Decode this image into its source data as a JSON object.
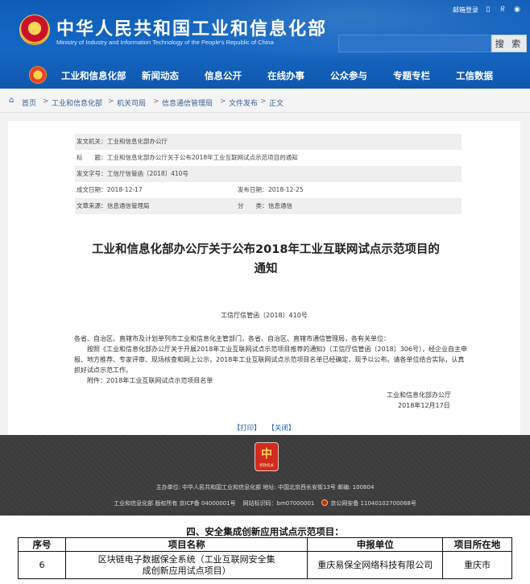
{
  "header": {
    "site_title": "中华人民共和国工业和信息化部",
    "site_subtitle": "Ministry of Industry and Information Technology of the People's Republic of China",
    "mail_login": "邮箱登录",
    "search_button": "搜 索",
    "nav": [
      "工业和信息化部",
      "新闻动态",
      "信息公开",
      "在线办事",
      "公众参与",
      "专题专栏",
      "工信数据"
    ]
  },
  "breadcrumb": [
    "首页",
    "工业和信息化部",
    "机关司局",
    "信息通信管理局",
    "文件发布",
    "正文"
  ],
  "meta": {
    "issuer_label": "发文机关：",
    "issuer": "工业和信息化部办公厅",
    "title_label": "标　　题：",
    "title": "工业和信息化部办公厅关于公布2018年工业互联网试点示范项目的通知",
    "doc_no_label": "发文字号：",
    "doc_no": "工信厅信管函〔2018〕410号",
    "created_label": "成文日期：",
    "created": "2018-12-17",
    "published_label": "发布日期：",
    "published": "2018-12-25",
    "source_label": "文章来源：",
    "source": "信息通信管理局",
    "category_label": "分　　类：",
    "category": "信息通信"
  },
  "document": {
    "title_line1": "工业和信息化部办公厅关于公布2018年工业互联网试点示范项目的",
    "title_line2": "通知",
    "number": "工信厅信管函〔2018〕410号",
    "para1": "各省、自治区、直辖市及计划单列市工业和信息化主管部门，各省、自治区、直辖市通信管理局，各有关单位：",
    "para2": "按照《工业和信息化部办公厅关于开展2018年工业互联网试点示范项目推荐的通知》（工信厅信管函〔2018〕306号），经企业自主申报、地方推荐、专家评审、现场核查和网上公示，2018年工业互联网试点示范项目名单已经确定，现予以公布。请各单位结合实际，认真抓好试点示范工作。",
    "attachment": "附件：2018年工业互联网试点示范项目名单",
    "signer": "工业和信息化部办公厅",
    "sign_date": "2018年12月17日",
    "print_label": "【打印】",
    "close_label": "【关闭】"
  },
  "footer": {
    "logo_text": "党政机关",
    "line1": "主办单位: 中华人民共和国工业和信息化部 地址: 中国北京西长安街13号 邮编: 100804",
    "copyright": "工业和信息化部 版权所有 京ICP备 04000001号",
    "site_id": "网站标识码：bm07000001",
    "police": "京公网安备 11040102700068号"
  },
  "table": {
    "caption": "四、安全集成创新应用试点示范项目：",
    "headers": [
      "序号",
      "项目名称",
      "申报单位",
      "项目所在地"
    ],
    "row": {
      "no": "6",
      "name_line1": "区块链电子数据保全系统（工业互联网安全集",
      "name_line2": "成创新应用试点项目）",
      "unit": "重庆易保全网络科技有限公司",
      "location": "重庆市"
    }
  }
}
